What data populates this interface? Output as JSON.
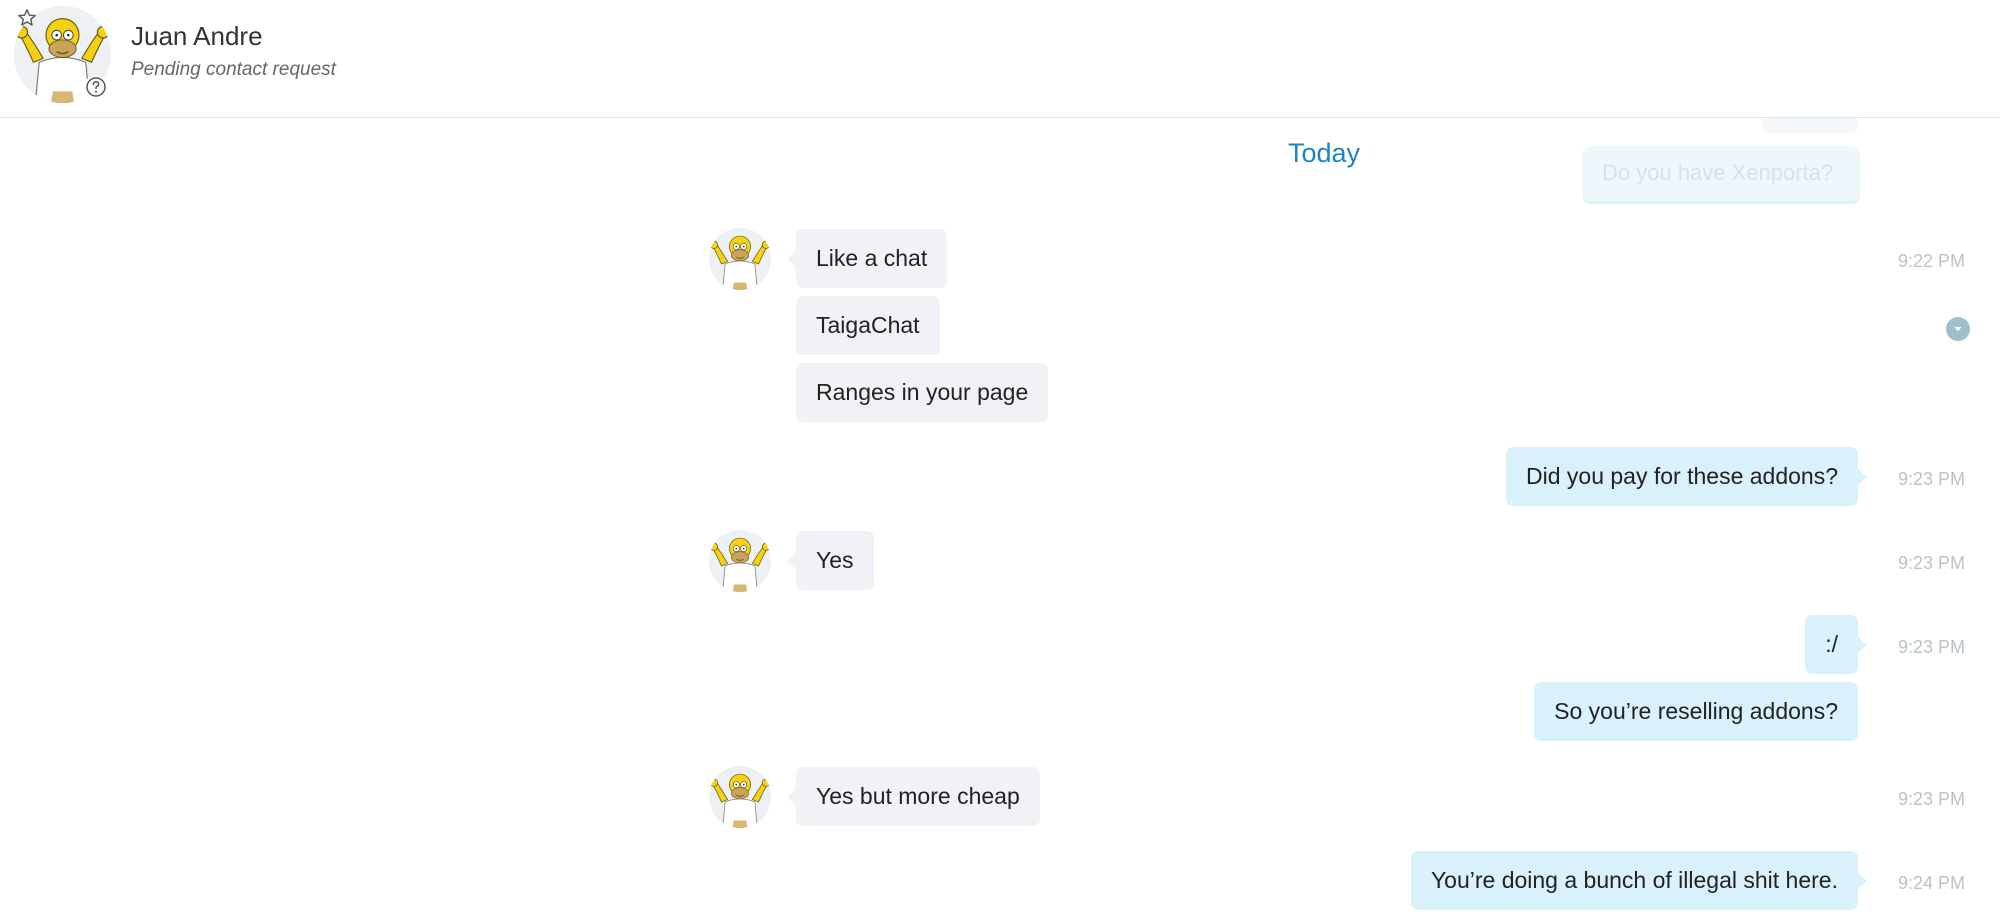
{
  "header": {
    "contact_name": "Juan Andre",
    "contact_status": "Pending contact request"
  },
  "chat": {
    "day_divider": "Today",
    "faded_message": "Do you have Xenporta?",
    "messages": [
      {
        "dir": "in",
        "text": "Like a chat",
        "time": "9:22 PM"
      },
      {
        "dir": "in",
        "text": "TaigaChat",
        "time": ""
      },
      {
        "dir": "in",
        "text": "Ranges in your page",
        "time": ""
      },
      {
        "dir": "out",
        "text": "Did you pay for these addons?",
        "time": "9:23 PM"
      },
      {
        "dir": "in",
        "text": "Yes",
        "time": "9:23 PM"
      },
      {
        "dir": "out",
        "text": ":/",
        "time": "9:23 PM"
      },
      {
        "dir": "out",
        "text": "So you’re reselling addons?",
        "time": ""
      },
      {
        "dir": "in",
        "text": "Yes but more cheap",
        "time": "9:23 PM"
      },
      {
        "dir": "out",
        "text": "You’re doing a bunch of illegal shit here.",
        "time": "9:24 PM"
      }
    ]
  },
  "icons": {
    "favorite": "star-outline-icon",
    "status": "question-mark-icon",
    "message_options": "chevron-down-icon"
  },
  "colors": {
    "accent": "#1a86c0",
    "incoming_bubble": "#f0f2f5",
    "outgoing_bubble": "#d9f1fb",
    "timestamp": "#b9c3c9"
  }
}
